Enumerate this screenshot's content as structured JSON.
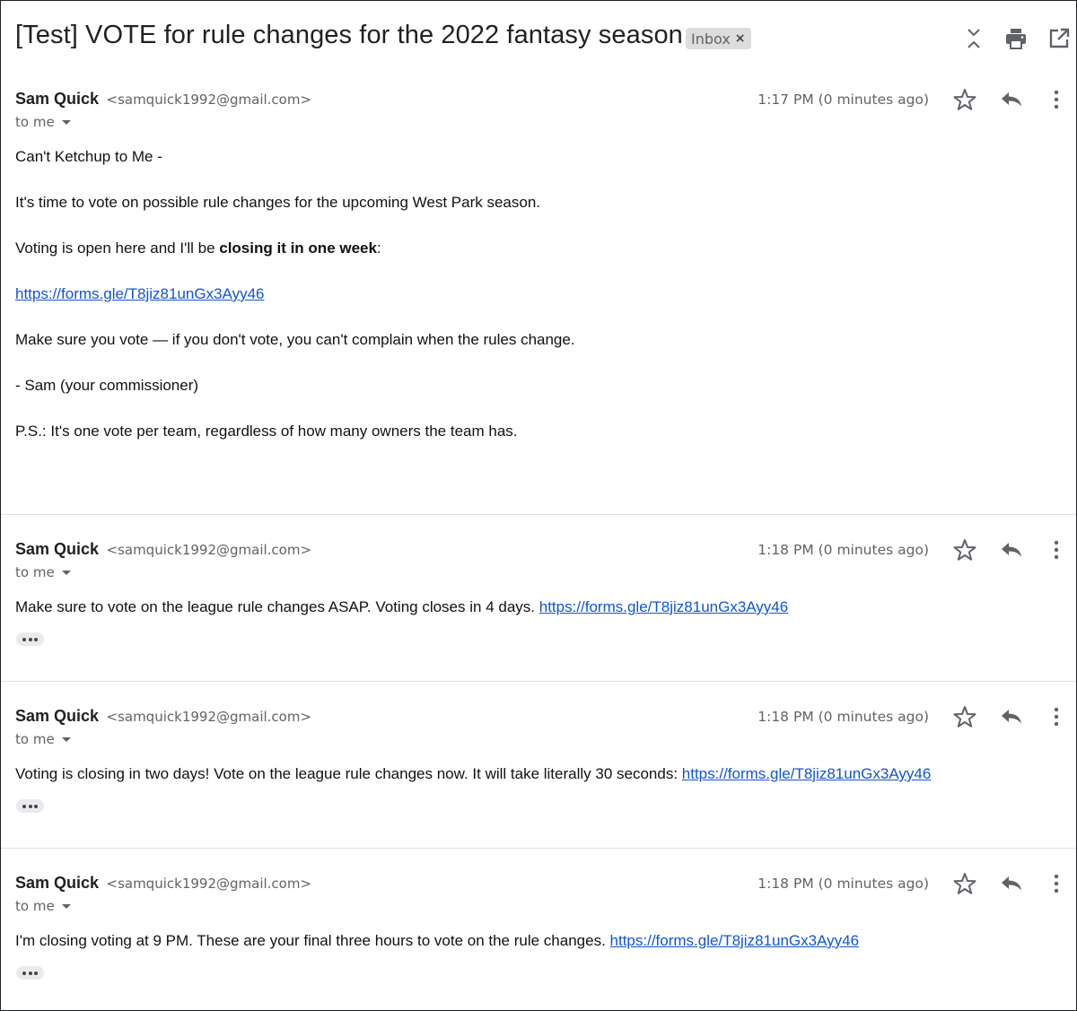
{
  "subject": "[Test] VOTE for rule changes for the 2022 fantasy season",
  "label": {
    "name": "Inbox",
    "remove": "×"
  },
  "header_icons": [
    "collapse-all-icon",
    "print-icon",
    "open-in-new-window-icon"
  ],
  "colors": {
    "link": "#1155cc",
    "muted": "#5f6368",
    "chip_bg": "#dddddd"
  },
  "messages": [
    {
      "sender_name": "Sam Quick",
      "sender_email": "<samquick1992@gmail.com>",
      "to": "to me",
      "time": "1:17 PM (0 minutes ago)",
      "greeting": "Can't Ketchup to Me -",
      "p1": "It's time to vote on possible rule changes for the upcoming West Park season.",
      "p2_before": "Voting is open here and I'll be ",
      "p2_bold": "closing it in one week",
      "p2_after": ":",
      "link": "https://forms.gle/T8jiz81unGx3Ayy46",
      "p3": "Make sure you vote — if you don't vote, you can't complain when the rules change.",
      "sign": "- Sam (your commissioner)",
      "ps": "P.S.: It's one vote per team, regardless of how many owners the team has."
    },
    {
      "sender_name": "Sam Quick",
      "sender_email": "<samquick1992@gmail.com>",
      "to": "to me",
      "time": "1:18 PM (0 minutes ago)",
      "text": "Make sure to vote on the league rule changes ASAP. Voting closes in 4 days. ",
      "link": "https://forms.gle/T8jiz81unGx3Ayy46"
    },
    {
      "sender_name": "Sam Quick",
      "sender_email": "<samquick1992@gmail.com>",
      "to": "to me",
      "time": "1:18 PM (0 minutes ago)",
      "text": "Voting is closing in two days! Vote on the league rule changes now. It will take literally 30 seconds: ",
      "link": "https://forms.gle/T8jiz81unGx3Ayy46"
    },
    {
      "sender_name": "Sam Quick",
      "sender_email": "<samquick1992@gmail.com>",
      "to": "to me",
      "time": "1:18 PM (0 minutes ago)",
      "text": "I'm closing voting at 9 PM. These are your final three hours to vote on the rule changes. ",
      "link": "https://forms.gle/T8jiz81unGx3Ayy46"
    }
  ]
}
